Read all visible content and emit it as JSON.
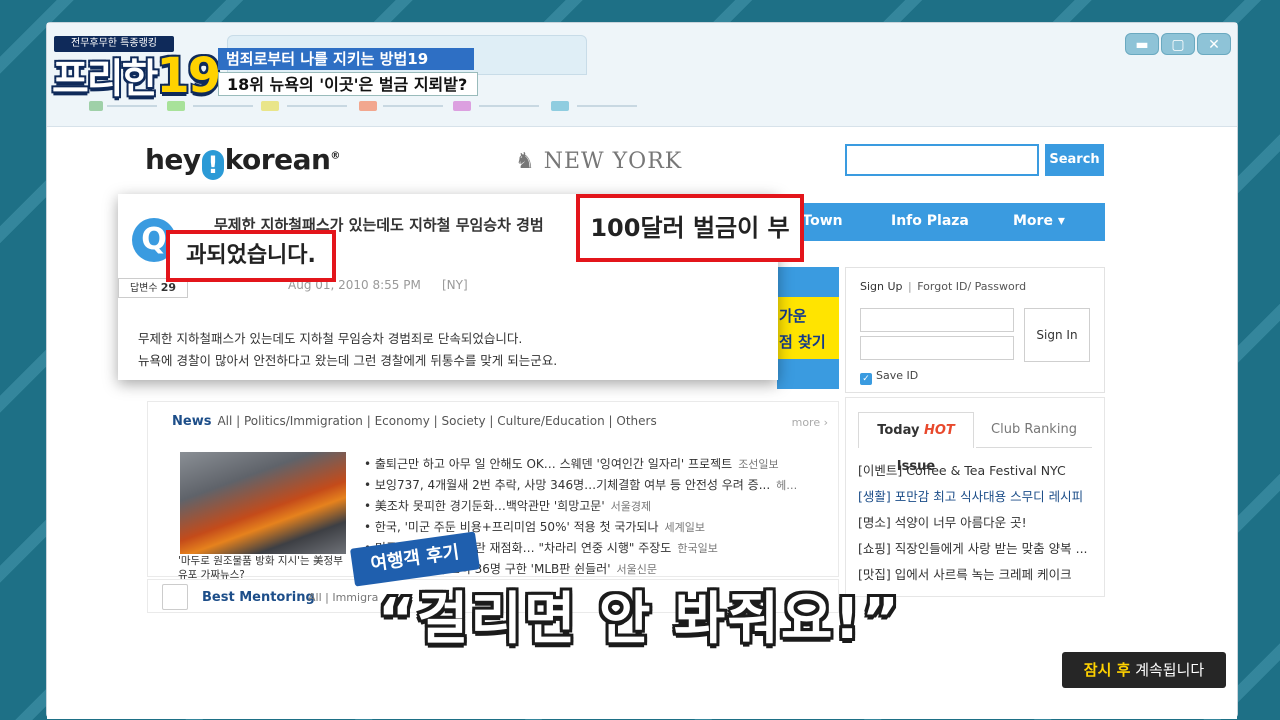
{
  "show": {
    "badge_top": "전무후무한 특종랭킹",
    "logo_text": "프리한",
    "logo_num": "19",
    "topic_line1": "범죄로부터 나를 지키는 방법19",
    "topic_line2": "18위 뉴욕의 '이곳'은 벌금 지뢰밭?"
  },
  "window_controls": {
    "minimize": "▬",
    "maximize": "▢",
    "close": "✕"
  },
  "site": {
    "logo_left": "hey",
    "logo_bang": "!",
    "logo_right": "korean",
    "logo_reg": "®",
    "region": "NEW YORK",
    "search_button": "Search",
    "nav": {
      "ktown": "K-Town",
      "infoplaza": "Info Plaza",
      "more": "More  ▾"
    },
    "ad_text": "가운\n점 찾기 ▶",
    "login": {
      "signup": "Sign Up",
      "forgot": "Forgot ID/ Password",
      "signin": "Sign In",
      "save_id": "Save ID"
    },
    "hot_issue": {
      "tab_today": "Today ",
      "tab_hot": "HOT",
      "tab_issue": " Issue",
      "tab_club": "Club Ranking",
      "items": [
        "[이벤트] Coffee & Tea Festival NYC",
        "[생활] 포만감 최고 식사대용 스무디 레시피",
        "[명소] 석양이 너무 아름다운 곳!",
        "[쇼핑] 직장인들에게 사랑 받는 맞춤 양복 ...",
        "[맛집] 입에서 사르륵 녹는 크레페 케이크"
      ]
    },
    "news": {
      "label": "News",
      "categories": "All | Politics/Immigration | Economy | Society | Culture/Education | Others",
      "more": "more ›",
      "photo_caption": "'마두로 원조물품 방화 지시'는 美정부 유포 가짜뉴스?",
      "items": [
        {
          "text": "• 출퇴근만 하고 아무 일 안해도 OK… 스웨덴 '잉여인간 일자리' 프로젝트",
          "source": "조선일보"
        },
        {
          "text": "• 보잉737, 4개월새 2번 추락, 사망 346명…기체결함 여부 등 안전성 우려 증...",
          "source": "헤…"
        },
        {
          "text": "• 美조차 못피한 경기둔화…백악관만 '희망고문'",
          "source": "서울경제"
        },
        {
          "text": "• 한국, '미군 주둔 비용+프리미엄 50%' 적용 첫 국가되나",
          "source": "세계일보"
        },
        {
          "text": "• 미국, 서머타임제 논란 재점화… \"차라리 연중 시행\" 주장도",
          "source": "한국일보"
        },
        {
          "text": "• 우간다 성노예 소녀 36명 구한 'MLB판 쉰들러'",
          "source": "서울신문"
        }
      ]
    },
    "mentor": {
      "title": "Best Mentoring",
      "categories": "All | Immigra"
    },
    "popup": {
      "q": "Q",
      "title": "무제한 지하철패스가 있는데도 지하철 무임승차 경범",
      "answers_label": "답변수 ",
      "answers_count": "29",
      "date": "Aug 01, 2010 8:55 PM",
      "region": "[NY]",
      "body_line1": "무제한 지하철패스가 있는데도 지하철 무임승차 경범죄로 단속되었습니다.",
      "body_line2": "뉴욕에 경찰이 많아서 안전하다고 왔는데 그런 경찰에게 뒤통수를 맞게 되는군요.",
      "zoom1": "100달러 벌금이 부",
      "zoom2": "과되었습니다."
    }
  },
  "captions": {
    "review_tag": "여행객 후기",
    "main": "“걸리면 안 봐줘요!”",
    "continue_hl": "잠시 후",
    "continue_rest": " 계속됩니다"
  },
  "colors": {
    "accent": "#3a9be0",
    "highlight_red": "#e3151b",
    "ad_yellow": "#ffe400"
  }
}
